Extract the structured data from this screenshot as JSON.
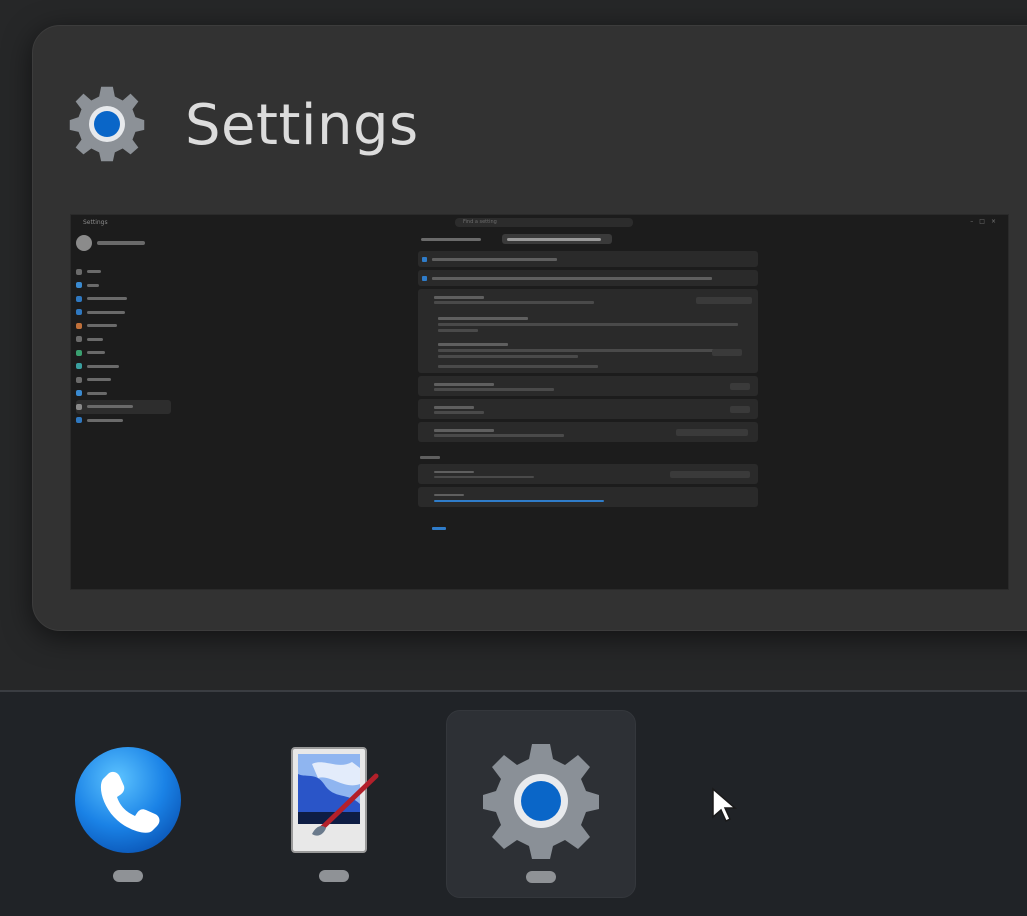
{
  "flyout": {
    "title": "Settings",
    "icon": "gear-icon"
  },
  "preview": {
    "app_name": "Settings",
    "search_placeholder": "Find a setting"
  },
  "taskbar": {
    "items": [
      {
        "name": "phone-link",
        "icon": "phone-icon",
        "active": false
      },
      {
        "name": "paint",
        "icon": "paint-icon",
        "active": false
      },
      {
        "name": "settings",
        "icon": "gear-icon",
        "active": true
      }
    ]
  },
  "colors": {
    "accent": "#0a66c8",
    "taskbar_bg": "#202327",
    "flyout_bg": "#323232"
  }
}
